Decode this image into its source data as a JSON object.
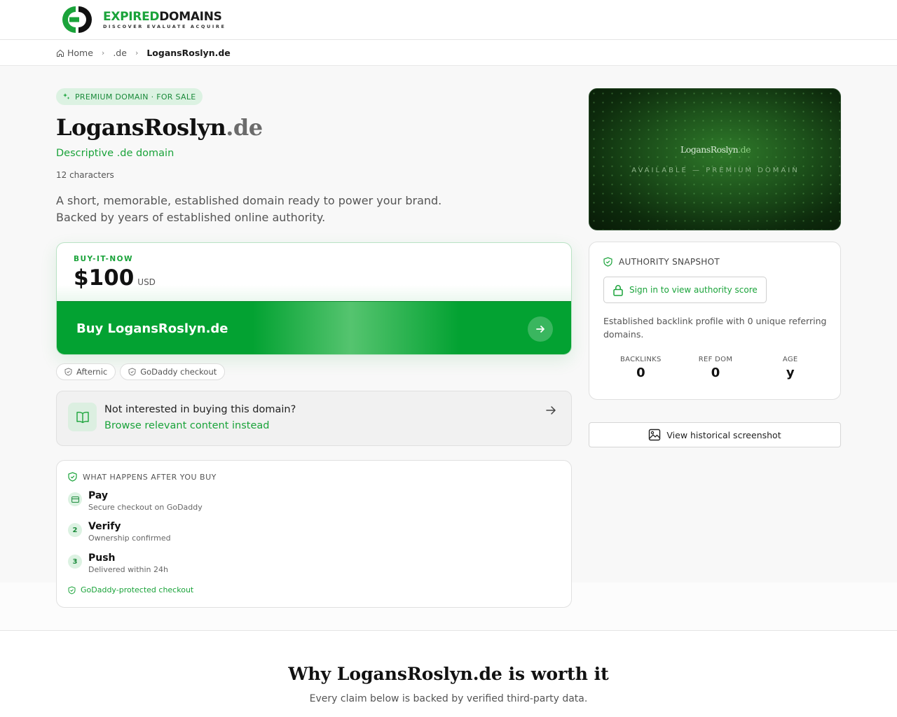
{
  "header": {
    "logo_word_green": "EXPIRED",
    "logo_word_dark": "DOMAINS",
    "logo_tagline": "DISCOVER EVALUATE ACQUIRE"
  },
  "breadcrumb": {
    "items": [
      "Home",
      ".de",
      "LogansRoslyn.de"
    ]
  },
  "hero": {
    "badge": "PREMIUM DOMAIN · FOR SALE",
    "domain_name": "LogansRoslyn",
    "domain_tld": ".de",
    "descriptor": "Descriptive .de domain",
    "char_count": "12 characters",
    "lead_line_1": "A short, memorable, established domain ready to power your brand.",
    "lead_line_2": "Backed by years of established online authority."
  },
  "buy": {
    "label": "BUY-IT-NOW",
    "price": "$100",
    "currency": "USD",
    "button": "Buy LogansRoslyn.de"
  },
  "tags": [
    "Afternic",
    "GoDaddy checkout"
  ],
  "not_interested": {
    "question": "Not interested in buying this domain?",
    "link": "Browse relevant content instead"
  },
  "after_buy": {
    "heading": "WHAT HAPPENS AFTER YOU BUY",
    "steps": [
      {
        "num": "",
        "title": "Pay",
        "sub": "Secure checkout on GoDaddy"
      },
      {
        "num": "2",
        "title": "Verify",
        "sub": "Ownership confirmed"
      },
      {
        "num": "3",
        "title": "Push",
        "sub": "Delivered within 24h"
      }
    ],
    "protected": "GoDaddy-protected checkout"
  },
  "preview": {
    "name": "LogansRoslyn",
    "tld": ".de",
    "status": "AVAILABLE — PREMIUM DOMAIN"
  },
  "authority": {
    "heading": "AUTHORITY SNAPSHOT",
    "signin": "Sign in to view authority score",
    "profile": "Established backlink profile with 0 unique referring domains.",
    "stats": [
      {
        "label": "BACKLINKS",
        "value": "0"
      },
      {
        "label": "REF DOM",
        "value": "0"
      },
      {
        "label": "AGE",
        "value": "y"
      }
    ]
  },
  "history_button": "View historical screenshot",
  "why": {
    "title": "Why LogansRoslyn.de is worth it",
    "subtitle": "Every claim below is backed by verified third-party data."
  },
  "colors": {
    "brand_green": "#1aa33a",
    "button_green": "#03a232"
  }
}
